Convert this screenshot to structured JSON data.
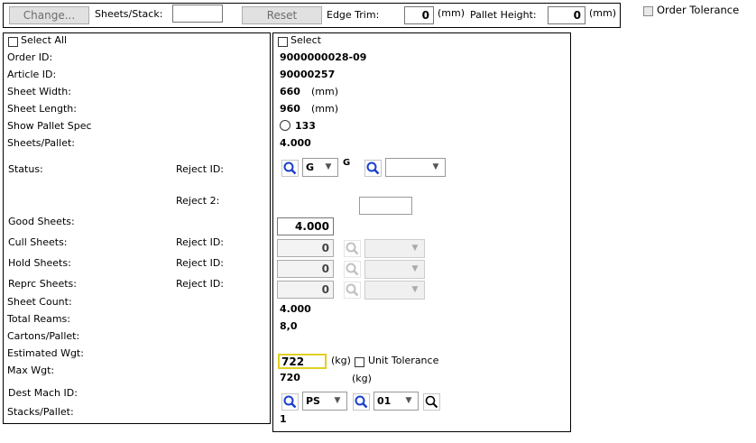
{
  "toolbar": {
    "change_label": "Change...",
    "sheets_stack_label": "Sheets/Stack:",
    "sheets_stack_value": "",
    "reset_label": "Reset",
    "edge_trim_label": "Edge Trim:",
    "edge_trim_value": "0",
    "edge_trim_unit": "(mm)",
    "pallet_height_label": "Pallet Height:",
    "pallet_height_value": "0",
    "pallet_height_unit": "(mm)"
  },
  "order_tolerance_label": "Order Tolerance",
  "left": {
    "select_all": "Select All",
    "order_id": "Order ID:",
    "article_id": "Article ID:",
    "sheet_width": "Sheet Width:",
    "sheet_length": "Sheet Length:",
    "show_pallet_spec": "Show Pallet Spec",
    "sheets_pallet": "Sheets/Pallet:",
    "status": "Status:",
    "reject_id": "Reject ID:",
    "reject_2": "Reject 2:",
    "good_sheets": "Good Sheets:",
    "cull_sheets": "Cull Sheets:",
    "cull_reject": "Reject ID:",
    "hold_sheets": "Hold Sheets:",
    "hold_reject": "Reject ID:",
    "reprc_sheets": "Reprc Sheets:",
    "reprc_reject": "Reject ID:",
    "sheet_count": "Sheet Count:",
    "total_reams": "Total Reams:",
    "cartons_pallet": "Cartons/Pallet:",
    "estimated_wgt": "Estimated Wgt:",
    "max_wgt": "Max Wgt:",
    "dest_mach_id": "Dest Mach ID:",
    "stacks_pallet": "Stacks/Pallet:"
  },
  "right": {
    "select": "Select",
    "order_id": "9000000028-09",
    "article_id": "90000257",
    "sheet_width": "660",
    "sheet_width_unit": "(mm)",
    "sheet_length": "960",
    "sheet_length_unit": "(mm)",
    "pallet_spec": "133",
    "sheets_pallet": "4.000",
    "status_value": "G",
    "status_text": "G",
    "reject_id_value": "",
    "reject_2_value": "",
    "good_sheets": "4.000",
    "cull_sheets": "0",
    "hold_sheets": "0",
    "reprc_sheets": "0",
    "sheet_count": "4.000",
    "total_reams": "8,0",
    "estimated_wgt": "722",
    "kg1": "(kg)",
    "unit_tolerance": "Unit Tolerance",
    "max_wgt": "720",
    "kg2": "(kg)",
    "dest_mach": "PS",
    "dest_mach_2": "01",
    "stacks_pallet": "1"
  }
}
